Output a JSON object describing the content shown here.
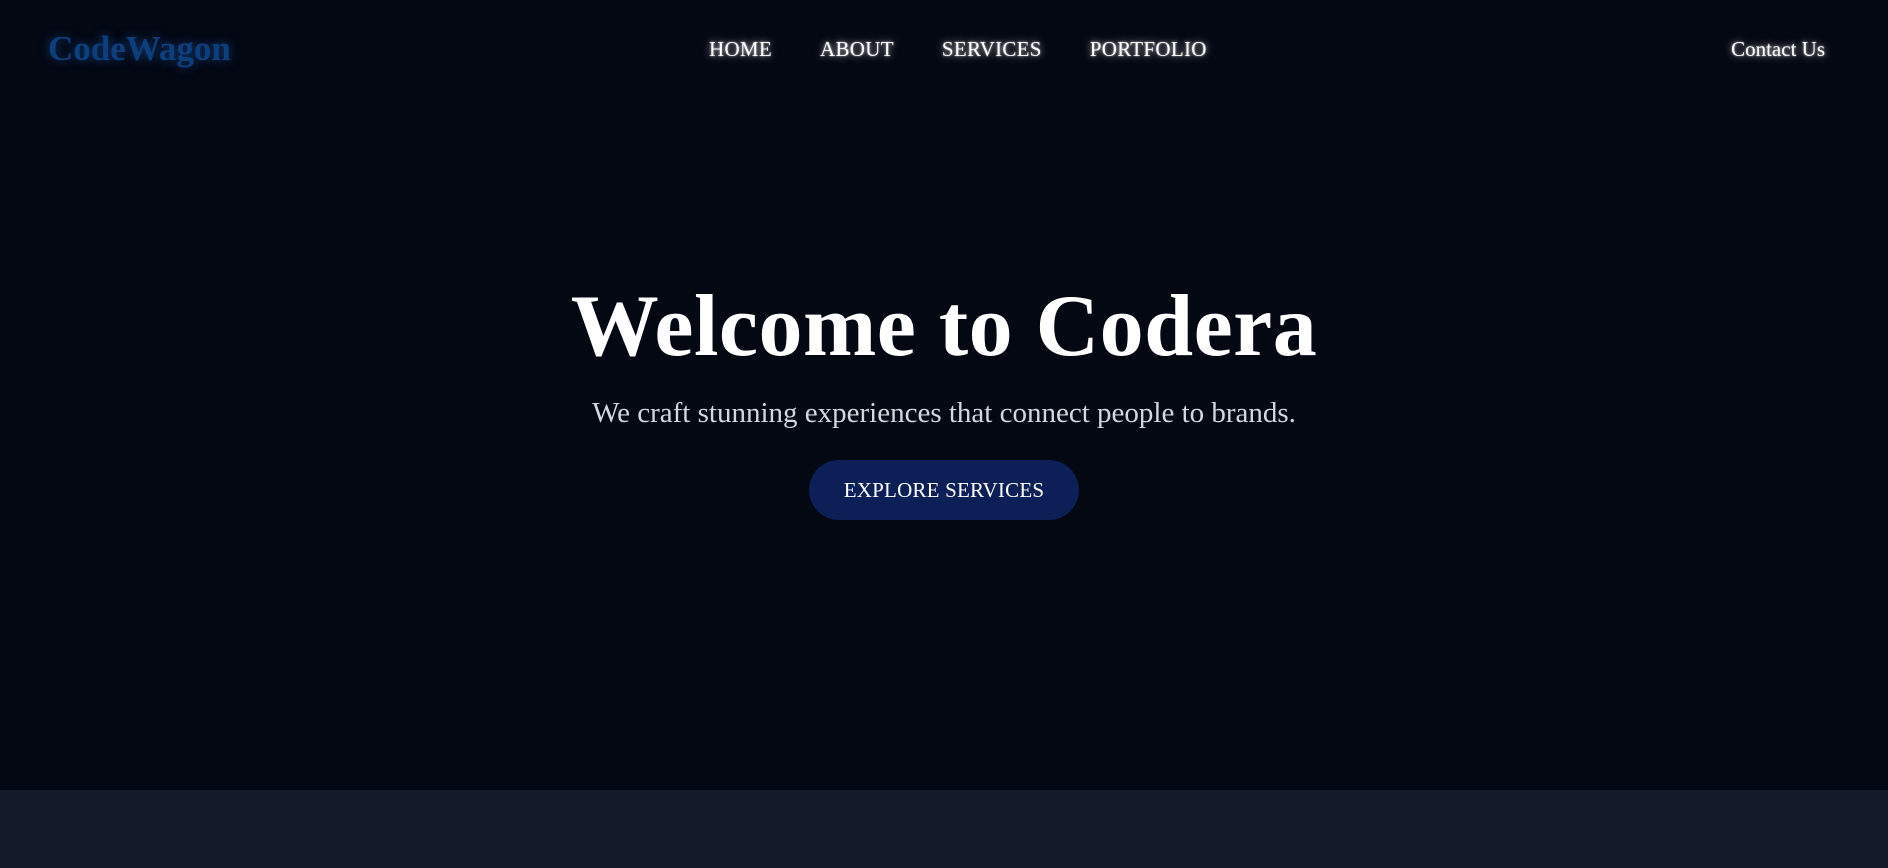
{
  "header": {
    "logo": "CodeWagon",
    "nav": [
      {
        "label": "HOME"
      },
      {
        "label": "ABOUT"
      },
      {
        "label": "SERVICES"
      },
      {
        "label": "PORTFOLIO"
      }
    ],
    "contact_label": "Contact Us"
  },
  "hero": {
    "title": "Welcome to Codera",
    "subtitle": "We craft stunning experiences that connect people to brands.",
    "cta_label": "EXPLORE SERVICES"
  },
  "colors": {
    "background": "#040813",
    "logo": "#0d3f7c",
    "cta_background": "#0c1f57",
    "next_section_background": "#131a2a"
  }
}
